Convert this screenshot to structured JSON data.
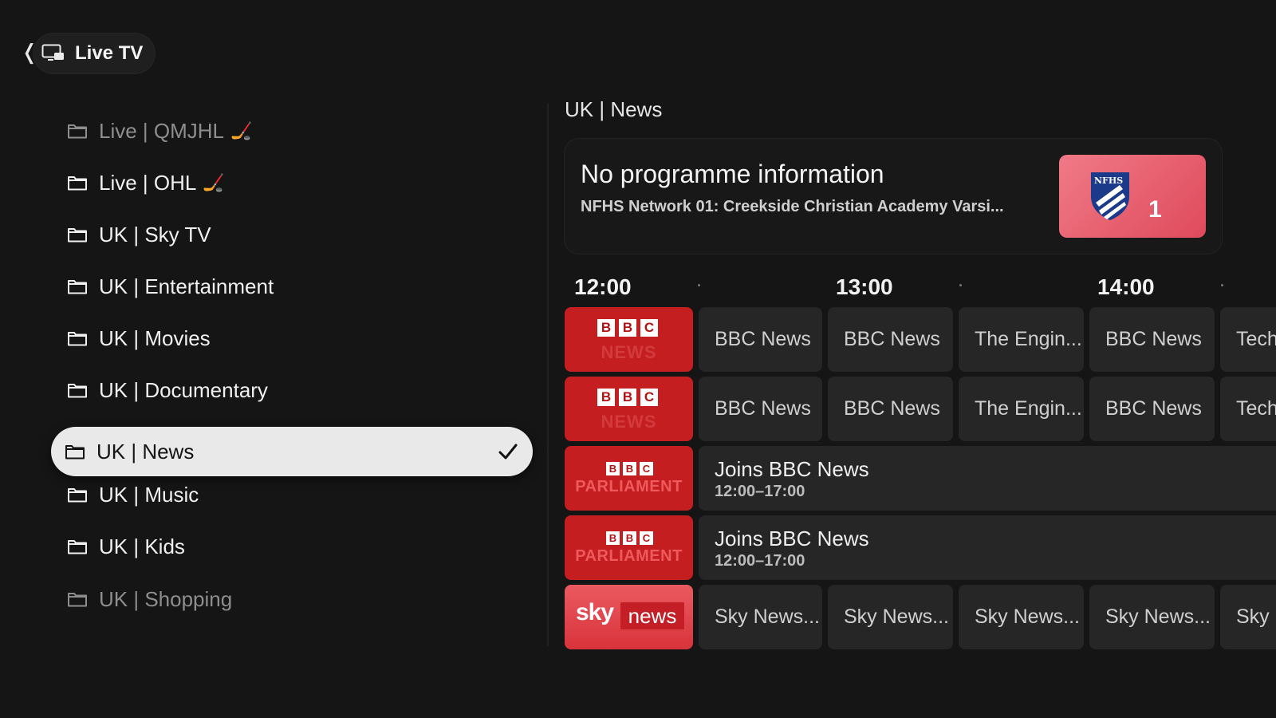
{
  "header": {
    "back_label": "Live TV"
  },
  "sidebar": {
    "items": [
      {
        "label": "Live | QMJHL",
        "emoji": "🏒"
      },
      {
        "label": "Live | OHL",
        "emoji": "🏒"
      },
      {
        "label": "UK | Sky TV"
      },
      {
        "label": "UK | Entertainment"
      },
      {
        "label": "UK | Movies"
      },
      {
        "label": "UK | Documentary"
      },
      {
        "label": "UK | News",
        "selected": true
      },
      {
        "label": "UK | Music"
      },
      {
        "label": "UK | Kids"
      },
      {
        "label": "UK | Shopping"
      }
    ]
  },
  "panel": {
    "group_title": "UK | News",
    "info": {
      "title": "No programme information",
      "subtitle": "NFHS Network 01: Creekside Christian Academy Varsi...",
      "logo_text": "NFHS NETWORK",
      "channel_number": "1"
    },
    "timeline": [
      "12:00",
      "13:00",
      "14:00"
    ],
    "channels": [
      {
        "logo": "bbc-news",
        "logo_letters": [
          "B",
          "B",
          "C"
        ],
        "logo_sub": "NEWS",
        "programmes": [
          "BBC News",
          "BBC News",
          "The Engin...",
          "BBC News",
          "Tech"
        ]
      },
      {
        "logo": "bbc-news",
        "logo_letters": [
          "B",
          "B",
          "C"
        ],
        "logo_sub": "NEWS",
        "programmes": [
          "BBC News",
          "BBC News",
          "The Engin...",
          "BBC News",
          "Tech"
        ]
      },
      {
        "logo": "bbc-parliament",
        "logo_letters": [
          "B",
          "B",
          "C"
        ],
        "logo_sub": "PARLIAMENT",
        "programme": {
          "title": "Joins BBC News",
          "time": "12:00–17:00"
        }
      },
      {
        "logo": "bbc-parliament",
        "logo_letters": [
          "B",
          "B",
          "C"
        ],
        "logo_sub": "PARLIAMENT",
        "programme": {
          "title": "Joins BBC News",
          "time": "12:00–17:00"
        }
      },
      {
        "logo": "sky-news",
        "logo_brand": "sky",
        "logo_sub": "news",
        "programmes": [
          "Sky News...",
          "Sky News...",
          "Sky News...",
          "Sky News...",
          "Sky N"
        ]
      }
    ]
  },
  "colors": {
    "background": "#151515",
    "selected_item": "#e9e9e9",
    "bbc_red": "#c41e20",
    "sky_red": "#e0444b",
    "nfhs_pink": "#e85b6c",
    "programme_cell": "#262626"
  }
}
